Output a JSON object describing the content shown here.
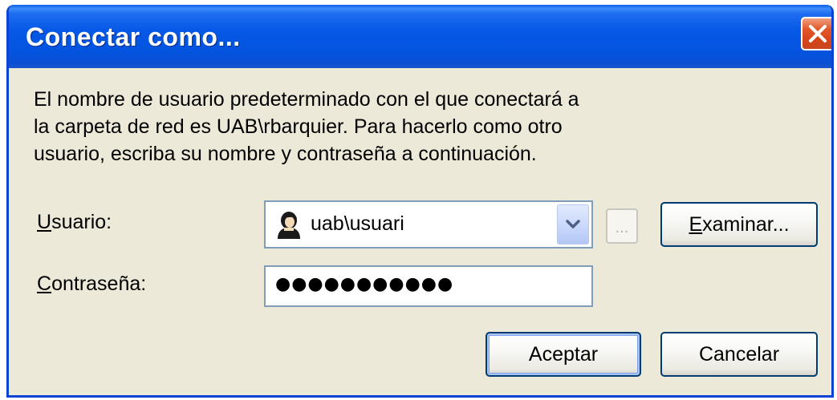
{
  "window": {
    "title": "Conectar como...",
    "close_label": "×"
  },
  "description": {
    "line1": "El nombre de usuario predeterminado con el que conectará a",
    "line2": "la carpeta de red es UAB\\rbarquier. Para hacerlo como otro",
    "line3": "usuario, escriba su nombre y contraseña a continuación."
  },
  "user_field": {
    "label_mnemonic": "U",
    "label_rest": "suario:",
    "value": "uab\\usuari",
    "icon": "user-avatar-icon"
  },
  "password_field": {
    "label_mnemonic": "C",
    "label_rest": "ontraseña:",
    "masked_value": "●●●●●●●●●●●"
  },
  "buttons": {
    "ellipsis_label": "...",
    "browse_mnemonic": "E",
    "browse_rest": "xaminar...",
    "ok_label": "Aceptar",
    "cancel_label": "Cancelar"
  },
  "colors": {
    "titlebar": "#0758e6",
    "window_bg": "#ece9d8",
    "close_button": "#d74419",
    "field_border": "#7f9db9",
    "button_border": "#003c74"
  }
}
